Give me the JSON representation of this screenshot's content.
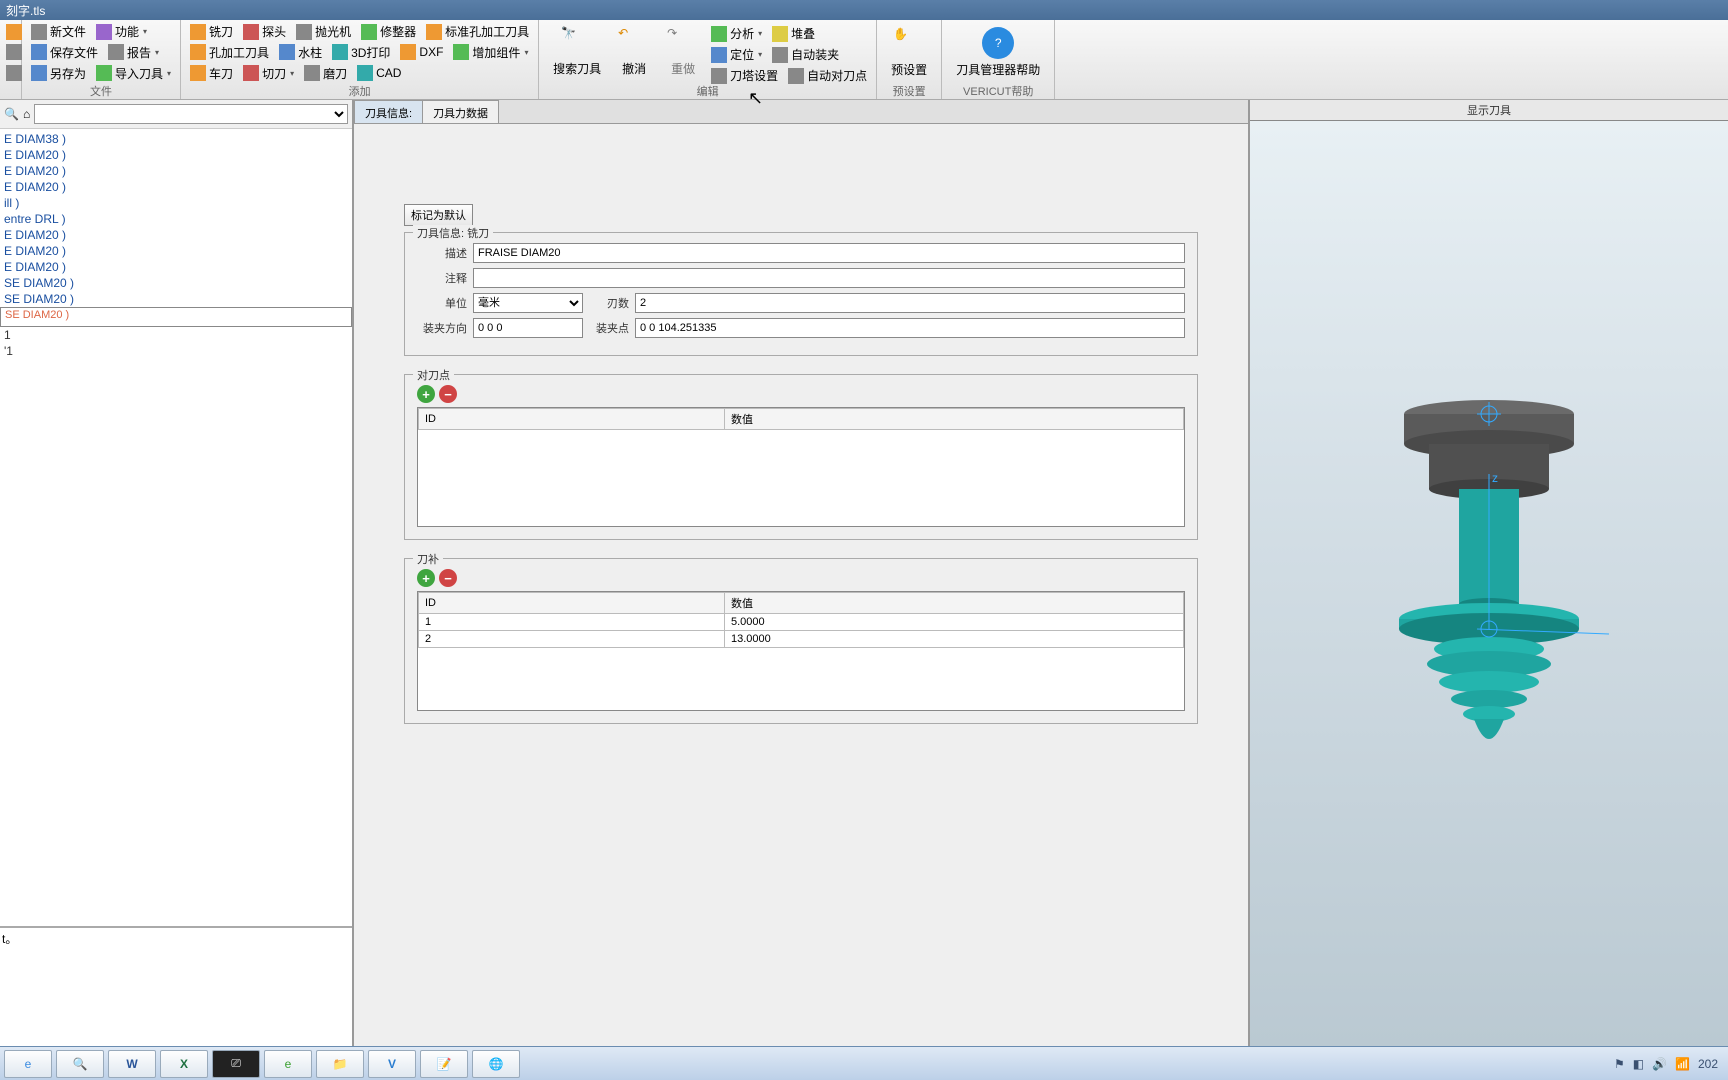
{
  "title_bar": "刻字.tls",
  "ribbon": {
    "group1": {
      "new_file": "新文件",
      "function": "功能",
      "save_file": "保存文件",
      "report": "报告",
      "save_as": "另存为",
      "import_tool": "导入刀具",
      "title": "文件"
    },
    "group2": {
      "mill": "铣刀",
      "probe": "探头",
      "polish": "抛光机",
      "dresser": "修整器",
      "std_hole": "标准孔加工刀具",
      "hole_tool": "孔加工刀具",
      "water": "水柱",
      "print3d": "3D打印",
      "dxf": "DXF",
      "add_comp": "增加组件",
      "lathe": "车刀",
      "cut": "切刀",
      "grind": "磨刀",
      "cad": "CAD",
      "title": "添加"
    },
    "group3": {
      "search": "搜索刀具",
      "undo": "撤消",
      "redo": "重做",
      "analysis": "分析",
      "stack": "堆叠",
      "locate": "定位",
      "auto_clamp": "自动装夹",
      "turret": "刀塔设置",
      "auto_align": "自动对刀点",
      "title": "编辑"
    },
    "group4": {
      "preset": "预设置",
      "title": "预设置"
    },
    "group5": {
      "help": "刀具管理器帮助",
      "title": "VERICUT帮助"
    }
  },
  "tree": {
    "items": [
      "E DIAM38 )",
      "E DIAM20 )",
      "E DIAM20 )",
      "E DIAM20 )",
      "ill )",
      "entre DRL )",
      "E DIAM20 )",
      "E DIAM20 )",
      "E DIAM20 )",
      "SE DIAM20 )",
      "SE DIAM20 )"
    ],
    "selected": "SE DIAM20 )",
    "suffix1": "1",
    "suffix2": "'1"
  },
  "bottom_text": "t。",
  "tabs": {
    "info": "刀具信息:",
    "force": "刀具力数据"
  },
  "form": {
    "default_btn": "标记为默认",
    "toolinfo_legend": "刀具信息: 铣刀",
    "desc_lbl": "描述",
    "desc_val": "FRAISE DIAM20",
    "note_lbl": "注释",
    "note_val": "",
    "unit_lbl": "单位",
    "unit_val": "毫米",
    "teeth_lbl": "刃数",
    "teeth_val": "2",
    "orient_lbl": "装夹方向",
    "orient_val": "0 0 0",
    "point_lbl": "装夹点",
    "point_val": "0 0 104.251335",
    "gage_legend": "对刀点",
    "gage_cols": {
      "id": "ID",
      "val": "数值"
    },
    "comp_legend": "刀补",
    "comp_cols": {
      "id": "ID",
      "val": "数值"
    },
    "comp_rows": [
      {
        "id": "1",
        "val": "5.0000"
      },
      {
        "id": "2",
        "val": "13.0000"
      }
    ]
  },
  "right_panel": {
    "title": "显示刀具"
  },
  "taskbar": {
    "clock": "202"
  }
}
